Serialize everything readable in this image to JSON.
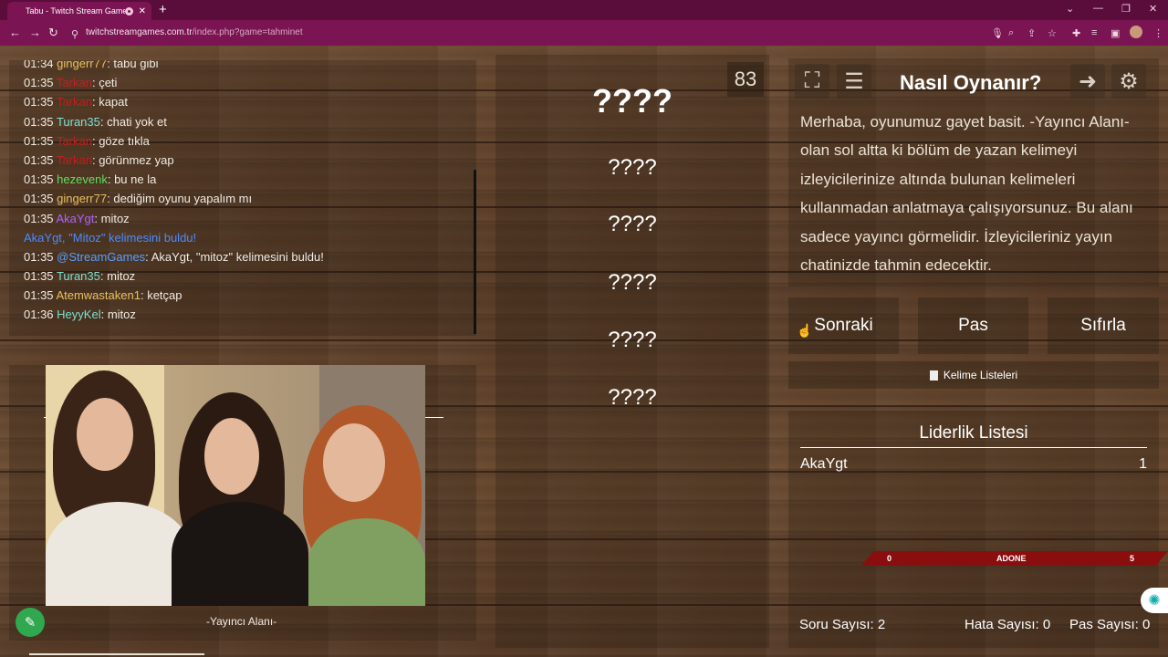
{
  "browser": {
    "tab_title": "Tabu - Twitch Stream Games",
    "tab_close": "✕",
    "new_tab": "+",
    "url_host": "twitchstreamgames.com.tr",
    "url_path": "/index.php?game=tahminet"
  },
  "chat": {
    "lines": [
      {
        "time": "01:34",
        "user": "gingerr77",
        "color": "#e8c060",
        "msg": "tabu gibi"
      },
      {
        "time": "01:35",
        "user": "Tarkan",
        "color": "#c02020",
        "msg": "çeti"
      },
      {
        "time": "01:35",
        "user": "Tarkan",
        "color": "#c02020",
        "msg": "kapat"
      },
      {
        "time": "01:35",
        "user": "Turan35",
        "color": "#7ee0d0",
        "msg": "chati yok et"
      },
      {
        "time": "01:35",
        "user": "Tarkan",
        "color": "#c02020",
        "msg": "göze tıkla"
      },
      {
        "time": "01:35",
        "user": "Tarkan",
        "color": "#c02020",
        "msg": "görünmez yap"
      },
      {
        "time": "01:35",
        "user": "hezevenk",
        "color": "#5ee05e",
        "msg": "bu ne la"
      },
      {
        "time": "01:35",
        "user": "gingerr77",
        "color": "#e8c060",
        "msg": "dediğim oyunu yapalım mı"
      },
      {
        "time": "01:35",
        "user": "AkaYgt",
        "color": "#b060ff",
        "msg": "mitoz"
      },
      {
        "time": "",
        "user": "",
        "color": "#4a8cff",
        "msg": "AkaYgt, \"Mitoz\" kelimesini buldu!",
        "system": true
      },
      {
        "time": "01:35",
        "user": "@StreamGames",
        "color": "#5aa0ff",
        "msg": "AkaYgt, \"mitoz\" kelimesini buldu!"
      },
      {
        "time": "01:35",
        "user": "Turan35",
        "color": "#7ee0d0",
        "msg": "mitoz"
      },
      {
        "time": "01:35",
        "user": "Atemwastaken1",
        "color": "#e8c060",
        "msg": "ketçap"
      },
      {
        "time": "01:36",
        "user": "HeyyKel",
        "color": "#7ee0d0",
        "msg": "mitoz"
      }
    ]
  },
  "streamer": {
    "label": "-Yayıncı Alanı-",
    "edit_icon": "✎"
  },
  "words": {
    "counter": "83",
    "main": "????",
    "items": [
      "????",
      "????",
      "????",
      "????",
      "????"
    ]
  },
  "how": {
    "title": "Nasıl Oynanır?",
    "text": "Merhaba, oyunumuz gayet basit. -Yayıncı Alanı- olan sol altta ki bölüm de yazan kelimeyi izleyicilerinize altında bulunan kelimeleri kullanmadan anlatmaya çalışıyorsunuz. Bu alanı sadece yayıncı görmelidir. İzleyicileriniz yayın chatinizde tahmin edecektir."
  },
  "buttons": {
    "next": "Sonraki",
    "pass": "Pas",
    "reset": "Sıfırla",
    "word_lists": "Kelime Listeleri"
  },
  "leaderboard": {
    "title": "Liderlik Listesi",
    "rows": [
      {
        "name": "AkaYgt",
        "score": "1"
      }
    ]
  },
  "adone": {
    "left": "0",
    "label": "ADONE",
    "right": "5"
  },
  "stats": {
    "questions": "Soru Sayısı: 2",
    "errors": "Hata Sayısı: 0",
    "passes": "Pas Sayısı: 0"
  },
  "colors": {
    "browser_bar": "#7a1452",
    "adone_bar": "#8b0e0e",
    "edit_button": "#2fa84f"
  }
}
